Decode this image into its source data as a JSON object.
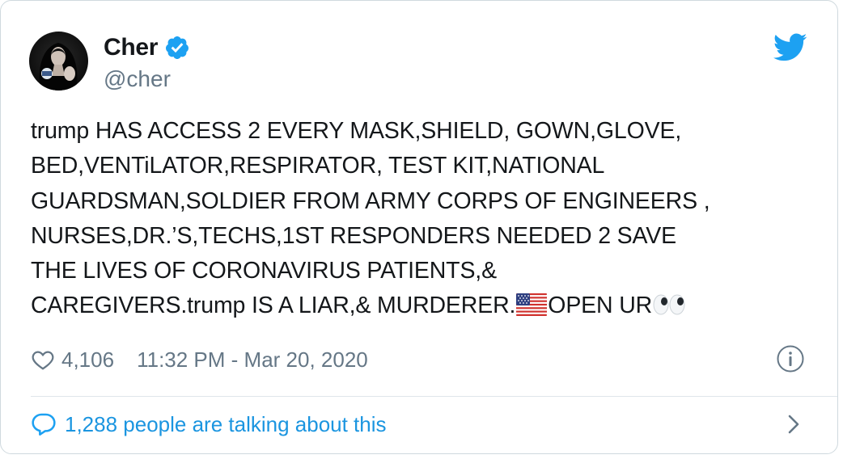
{
  "author": {
    "display_name": "Cher",
    "handle": "@cher",
    "verified": true,
    "avatar_icon": "avatar-photo"
  },
  "tweet": {
    "text_segment_1": "trump HAS ACCESS 2 EVERY MASK,SHIELD, GOWN,GLOVE,\nBED,VENTiLATOR,RESPIRATOR, TEST KIT,NATIONAL\nGUARDSMAN,SOLDIER FROM ARMY CORPS OF ENGINEERS ,\nNURSES,DR.’S,TECHS,1ST  RESPONDERS NEEDED 2 SAVE\nTHE LIVES OF CORONAVIRUS PATIENTS,&\nCAREGIVERS.trump IS A LIAR,& MURDERER.",
    "emoji_1": "us-flag-emoji",
    "text_segment_2": "OPEN UR",
    "emoji_2": "eyes-emoji"
  },
  "meta": {
    "likes": "4,106",
    "timestamp": "11:32 PM - Mar 20, 2020"
  },
  "footer": {
    "talking_label": "1,288 people are talking about this"
  },
  "colors": {
    "twitter_blue": "#1da1f2",
    "link_blue": "#1b95e0",
    "secondary_text": "#657786",
    "primary_text": "#14171a",
    "border": "#cfd9de"
  },
  "icons": {
    "brand": "twitter-bird-icon",
    "verified": "verified-badge-icon",
    "like": "heart-icon",
    "info": "info-icon",
    "conversation": "speech-bubble-icon",
    "navigate": "chevron-right-icon"
  }
}
